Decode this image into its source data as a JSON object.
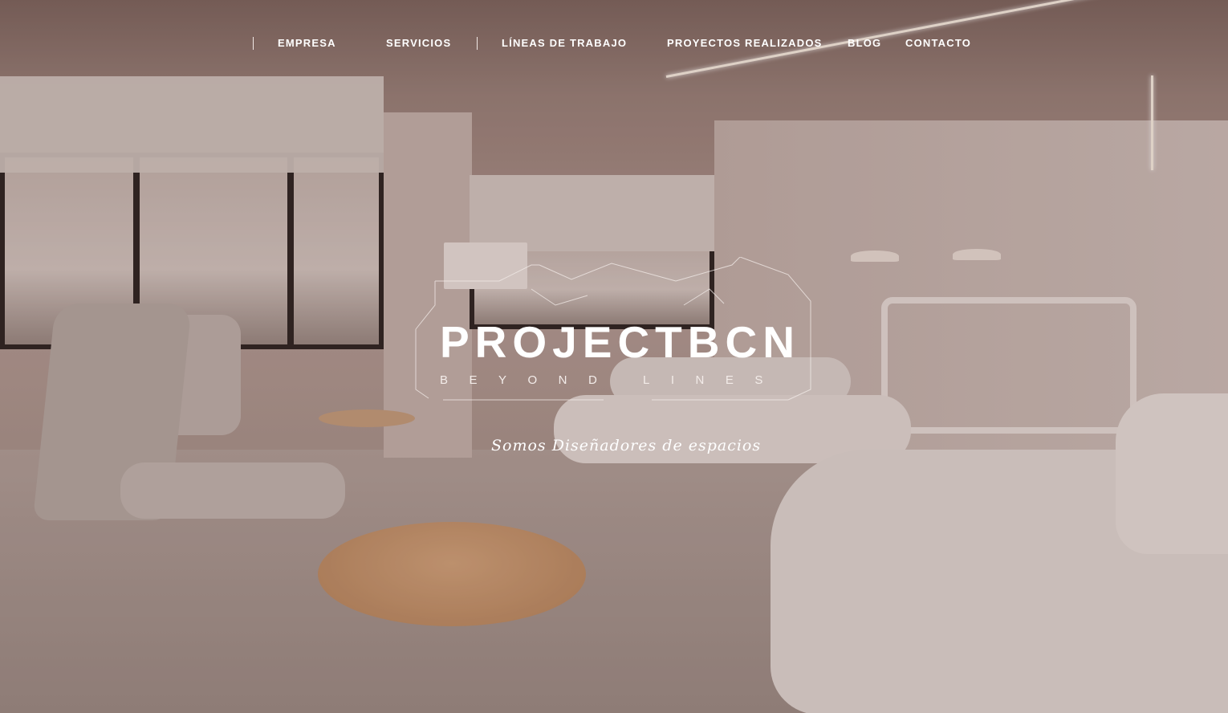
{
  "nav": {
    "items": [
      {
        "label": "EMPRESA"
      },
      {
        "label": "SERVICIOS"
      },
      {
        "label": "LÍNEAS DE TRABAJO"
      },
      {
        "label": "PROYECTOS REALIZADOS"
      },
      {
        "label": "BLOG"
      },
      {
        "label": "CONTACTO"
      }
    ]
  },
  "hero": {
    "brand": "PROJECTBCN",
    "subtitle": "BEYOND LINES",
    "tagline": "Somos Diseñadores de espacios"
  },
  "colors": {
    "text": "#ffffff",
    "overlay": "#5a3f3a"
  }
}
